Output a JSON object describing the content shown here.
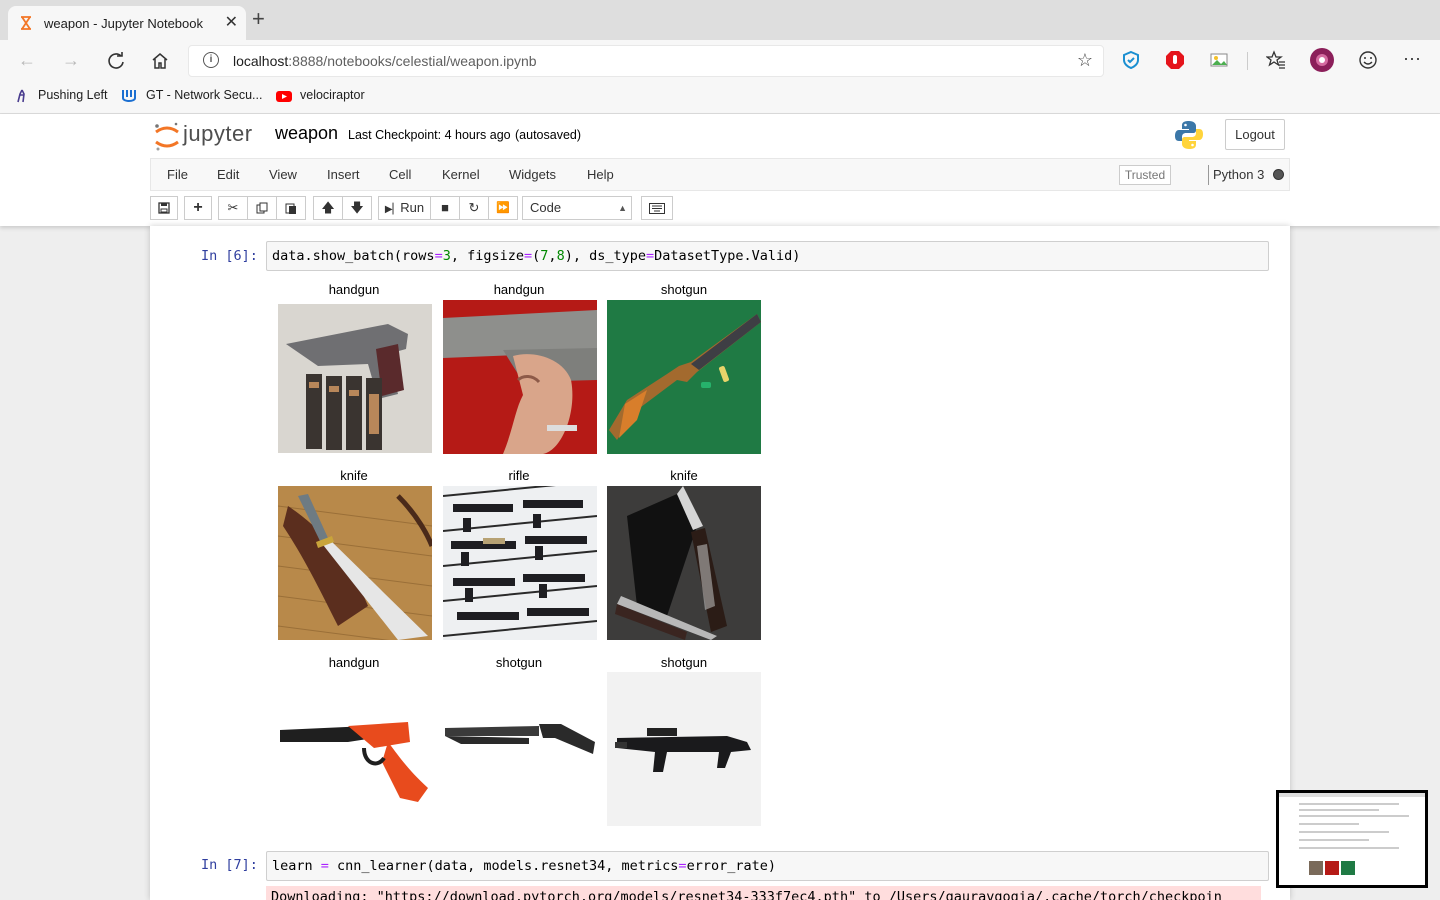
{
  "browser": {
    "tab_title": "weapon - Jupyter Notebook",
    "tab_close": "✕",
    "new_tab": "+",
    "url_host": "localhost",
    "url_rest": ":8888/notebooks/celestial/weapon.ipynb",
    "bookmarks": [
      {
        "label": "Pushing Left"
      },
      {
        "label": "GT - Network Secu..."
      },
      {
        "label": "velociraptor"
      }
    ]
  },
  "jupyter": {
    "logo_text": "jupyter",
    "notebook_name": "weapon",
    "checkpoint": "Last Checkpoint: 4 hours ago",
    "autosaved": "(autosaved)",
    "logout": "Logout",
    "menu": [
      "File",
      "Edit",
      "View",
      "Insert",
      "Cell",
      "Kernel",
      "Widgets",
      "Help"
    ],
    "trusted": "Trusted",
    "kernel": "Python 3",
    "run_label": "Run",
    "cell_type": "Code"
  },
  "cells": [
    {
      "prompt": "In [6]:",
      "code": "data.show_batch(rows=3, figsize=(7,8), ds_type=DatasetType.Valid)"
    },
    {
      "prompt": "In [7]:",
      "code": "learn = cnn_learner(data, models.resnet34, metrics=error_rate)",
      "stderr": "Downloading: \"https://download.pytorch.org/models/resnet34-333f7ec4.pth\" to /Users/gauravgogia/.cache/torch/checkpoin"
    }
  ],
  "batch_labels": [
    "handgun",
    "handgun",
    "shotgun",
    "knife",
    "rifle",
    "knife",
    "handgun",
    "shotgun",
    "shotgun"
  ],
  "colors": {
    "prompt": "#303f9f",
    "accent": "#f37626",
    "stderr_bg": "#ffdddd"
  }
}
